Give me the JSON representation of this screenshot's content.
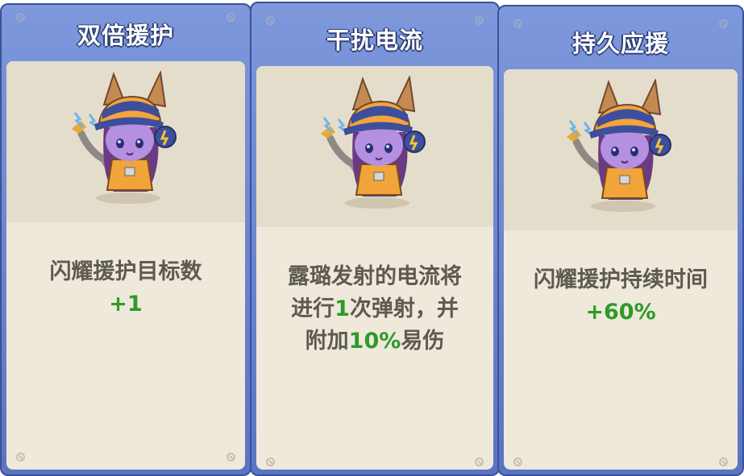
{
  "cards": [
    {
      "title": "双倍援护",
      "desc_line1": "闪耀援护目标数",
      "desc_value": "+1"
    },
    {
      "title": "干扰电流",
      "desc_line1": "露璐发射的电流将",
      "desc_line2_a": "进行",
      "desc_line2_hl": "1",
      "desc_line2_b": "次弹射，并",
      "desc_line3_a": "附加",
      "desc_line3_hl": "10%",
      "desc_line3_b": "易伤"
    },
    {
      "title": "持久应援",
      "desc_line1": "闪耀援护持续时间",
      "desc_value": "+60%"
    }
  ],
  "colors": {
    "card_blue": "#6f88d4",
    "panel_cream": "#efe9db",
    "highlight_green": "#2f9a2a",
    "text_gray": "#5e5a52"
  },
  "icons": [
    "lulu-character-portrait",
    "rivet-icon"
  ]
}
